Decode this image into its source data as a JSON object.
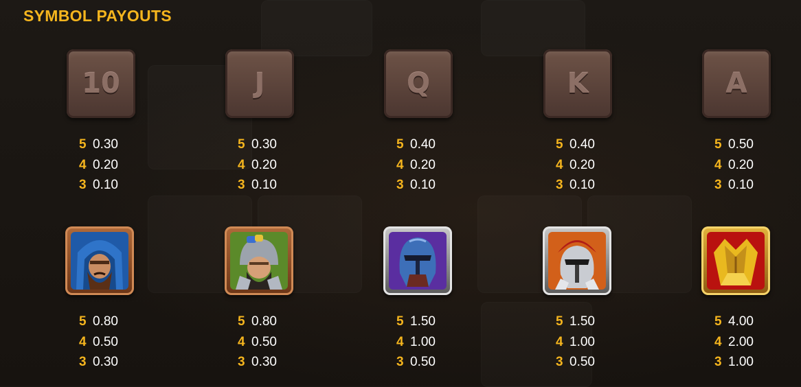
{
  "title": "SYMBOL PAYOUTS",
  "colors": {
    "accent": "#f5b51e",
    "background": "#1b1713",
    "value": "#ffffff"
  },
  "symbols": [
    {
      "name": "10",
      "kind": "low",
      "payouts": [
        {
          "count": "5",
          "value": "0.30"
        },
        {
          "count": "4",
          "value": "0.20"
        },
        {
          "count": "3",
          "value": "0.10"
        }
      ]
    },
    {
      "name": "J",
      "kind": "low",
      "payouts": [
        {
          "count": "5",
          "value": "0.30"
        },
        {
          "count": "4",
          "value": "0.20"
        },
        {
          "count": "3",
          "value": "0.10"
        }
      ]
    },
    {
      "name": "Q",
      "kind": "low",
      "payouts": [
        {
          "count": "5",
          "value": "0.40"
        },
        {
          "count": "4",
          "value": "0.20"
        },
        {
          "count": "3",
          "value": "0.10"
        }
      ]
    },
    {
      "name": "K",
      "kind": "low",
      "payouts": [
        {
          "count": "5",
          "value": "0.40"
        },
        {
          "count": "4",
          "value": "0.20"
        },
        {
          "count": "3",
          "value": "0.10"
        }
      ]
    },
    {
      "name": "A",
      "kind": "low",
      "payouts": [
        {
          "count": "5",
          "value": "0.50"
        },
        {
          "count": "4",
          "value": "0.20"
        },
        {
          "count": "3",
          "value": "0.10"
        }
      ]
    },
    {
      "name": "blue-hooded-dwarf",
      "kind": "high",
      "payouts": [
        {
          "count": "5",
          "value": "0.80"
        },
        {
          "count": "4",
          "value": "0.50"
        },
        {
          "count": "3",
          "value": "0.30"
        }
      ]
    },
    {
      "name": "helmeted-dwarf",
      "kind": "high",
      "payouts": [
        {
          "count": "5",
          "value": "0.80"
        },
        {
          "count": "4",
          "value": "0.50"
        },
        {
          "count": "3",
          "value": "0.30"
        }
      ]
    },
    {
      "name": "blue-knight-helmet",
      "kind": "high",
      "payouts": [
        {
          "count": "5",
          "value": "1.50"
        },
        {
          "count": "4",
          "value": "1.00"
        },
        {
          "count": "3",
          "value": "0.50"
        }
      ]
    },
    {
      "name": "red-crest-helmet",
      "kind": "high",
      "payouts": [
        {
          "count": "5",
          "value": "1.50"
        },
        {
          "count": "4",
          "value": "1.00"
        },
        {
          "count": "3",
          "value": "0.50"
        }
      ]
    },
    {
      "name": "golden-armor",
      "kind": "high",
      "payouts": [
        {
          "count": "5",
          "value": "4.00"
        },
        {
          "count": "4",
          "value": "2.00"
        },
        {
          "count": "3",
          "value": "1.00"
        }
      ]
    }
  ]
}
